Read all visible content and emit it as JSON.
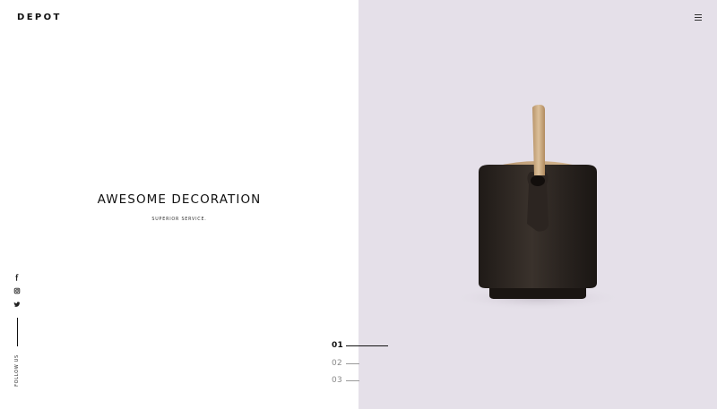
{
  "header": {
    "logo": "DEPOT",
    "menu_icon": "hamburger-menu-icon"
  },
  "hero": {
    "title": "AWESOME DECORATION",
    "subtitle": "SUPERIOR SERVICE."
  },
  "social": {
    "icons": [
      "facebook-icon",
      "instagram-icon",
      "twitter-icon"
    ],
    "follow_label": "FOLLOW US"
  },
  "slider": {
    "items": [
      {
        "label": "01",
        "active": true
      },
      {
        "label": "02",
        "active": false
      },
      {
        "label": "03",
        "active": false
      }
    ]
  },
  "colors": {
    "right_panel_bg": "#e5e0e9",
    "kettle_body": "#2a2420",
    "kettle_handle": "#c9a77e",
    "text": "#111111"
  }
}
